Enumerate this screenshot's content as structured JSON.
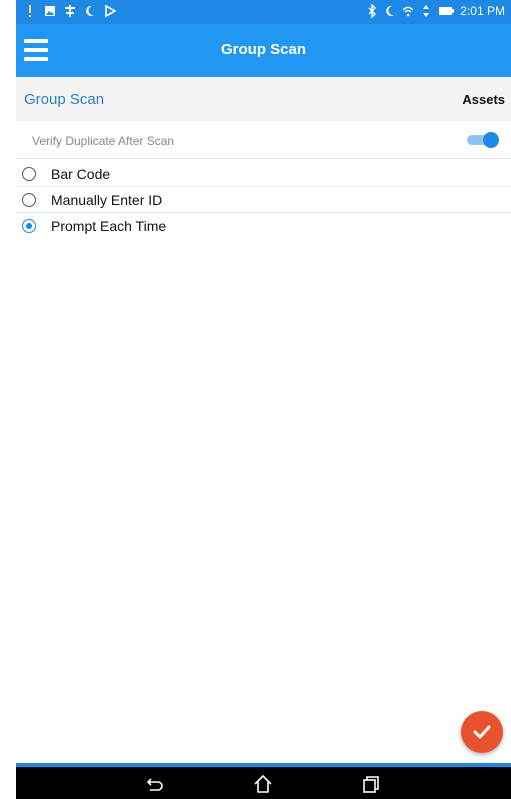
{
  "status_bar": {
    "time": "2:01 PM",
    "left_icons": [
      "alert-icon",
      "image-icon",
      "sim-icon",
      "moon-icon",
      "play-store-icon"
    ],
    "right_icons": [
      "bluetooth-icon",
      "moon-icon",
      "wifi-icon",
      "data-arrows-icon",
      "battery-icon"
    ]
  },
  "app_bar": {
    "title": "Group Scan",
    "menu_icon": "hamburger-menu-icon"
  },
  "section": {
    "title": "Group Scan",
    "right_label": "Assets"
  },
  "verify": {
    "label": "Verify Duplicate After Scan",
    "enabled": true
  },
  "options": [
    {
      "label": "Bar Code",
      "selected": false
    },
    {
      "label": "Manually Enter ID",
      "selected": false
    },
    {
      "label": "Prompt Each Time",
      "selected": true
    }
  ],
  "fab": {
    "icon": "checkmark-icon"
  },
  "nav_bar": {
    "icons": [
      "back-icon",
      "home-icon",
      "recent-apps-icon"
    ]
  },
  "colors": {
    "primary": "#2196f3",
    "status": "#1e88e5",
    "accent": "#e8532f",
    "link": "#2c7fc6"
  }
}
